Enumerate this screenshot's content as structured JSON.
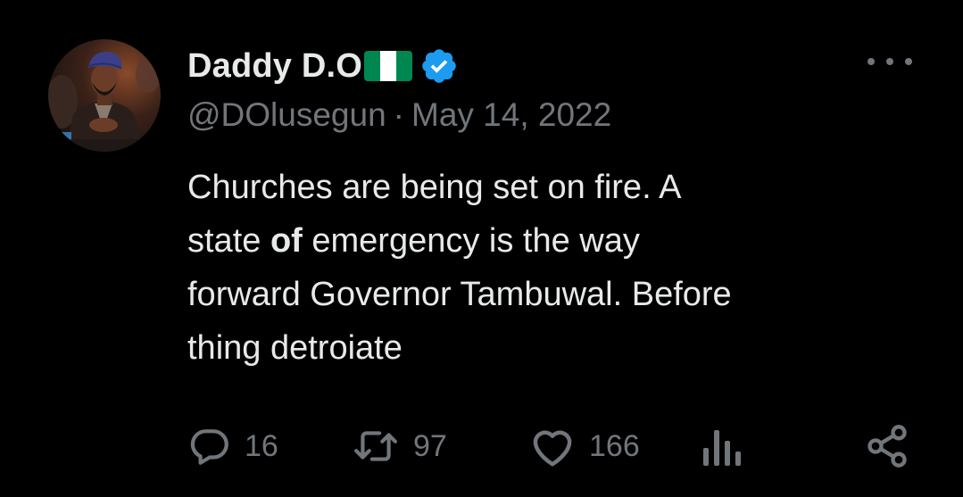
{
  "colors": {
    "background": "#000000",
    "primary_text": "#e7e9ea",
    "secondary_text": "#71767b",
    "verified_blue": "#1d9bf0",
    "flag_green": "#008751",
    "flag_white": "#ffffff"
  },
  "tweet": {
    "author": {
      "display_name": "Daddy D.O",
      "handle": "@DOlusegun",
      "verified": true,
      "flag_icon": "nigeria-flag-icon"
    },
    "separator": "·",
    "date": "May 14, 2022",
    "text": {
      "line1": "Churches are being set on fire. A",
      "line2_a": "state ",
      "line2_bold": "of",
      "line2_b": " emergency is the way",
      "line3": "forward Governor Tambuwal. Before",
      "line4": "thing detroiate"
    },
    "actions": {
      "reply": {
        "icon": "reply-icon",
        "count": "16"
      },
      "retweet": {
        "icon": "retweet-icon",
        "count": "97"
      },
      "like": {
        "icon": "heart-icon",
        "count": "166"
      },
      "views": {
        "icon": "analytics-icon"
      },
      "share": {
        "icon": "share-icon"
      }
    },
    "more_icon": "more-options-icon"
  }
}
